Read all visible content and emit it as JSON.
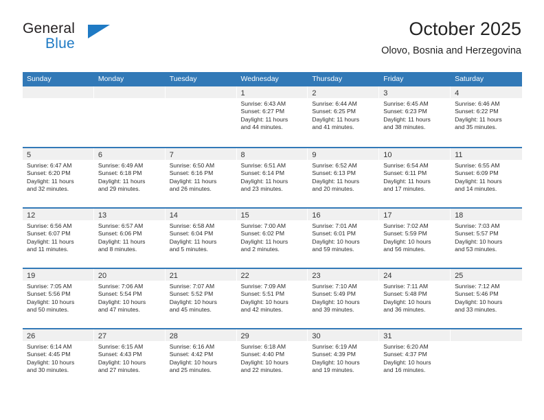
{
  "brand": {
    "name_top": "General",
    "name_bottom": "Blue",
    "accent_color": "#1f7ac4"
  },
  "header": {
    "title": "October 2025",
    "location": "Olovo, Bosnia and Herzegovina"
  },
  "calendar": {
    "header_color": "#3279b7",
    "weekdays": [
      "Sunday",
      "Monday",
      "Tuesday",
      "Wednesday",
      "Thursday",
      "Friday",
      "Saturday"
    ],
    "weeks": [
      [
        {
          "day": ""
        },
        {
          "day": ""
        },
        {
          "day": ""
        },
        {
          "day": "1",
          "sunrise": "Sunrise: 6:43 AM",
          "sunset": "Sunset: 6:27 PM",
          "daylight_1": "Daylight: 11 hours",
          "daylight_2": "and 44 minutes."
        },
        {
          "day": "2",
          "sunrise": "Sunrise: 6:44 AM",
          "sunset": "Sunset: 6:25 PM",
          "daylight_1": "Daylight: 11 hours",
          "daylight_2": "and 41 minutes."
        },
        {
          "day": "3",
          "sunrise": "Sunrise: 6:45 AM",
          "sunset": "Sunset: 6:23 PM",
          "daylight_1": "Daylight: 11 hours",
          "daylight_2": "and 38 minutes."
        },
        {
          "day": "4",
          "sunrise": "Sunrise: 6:46 AM",
          "sunset": "Sunset: 6:22 PM",
          "daylight_1": "Daylight: 11 hours",
          "daylight_2": "and 35 minutes."
        }
      ],
      [
        {
          "day": "5",
          "sunrise": "Sunrise: 6:47 AM",
          "sunset": "Sunset: 6:20 PM",
          "daylight_1": "Daylight: 11 hours",
          "daylight_2": "and 32 minutes."
        },
        {
          "day": "6",
          "sunrise": "Sunrise: 6:49 AM",
          "sunset": "Sunset: 6:18 PM",
          "daylight_1": "Daylight: 11 hours",
          "daylight_2": "and 29 minutes."
        },
        {
          "day": "7",
          "sunrise": "Sunrise: 6:50 AM",
          "sunset": "Sunset: 6:16 PM",
          "daylight_1": "Daylight: 11 hours",
          "daylight_2": "and 26 minutes."
        },
        {
          "day": "8",
          "sunrise": "Sunrise: 6:51 AM",
          "sunset": "Sunset: 6:14 PM",
          "daylight_1": "Daylight: 11 hours",
          "daylight_2": "and 23 minutes."
        },
        {
          "day": "9",
          "sunrise": "Sunrise: 6:52 AM",
          "sunset": "Sunset: 6:13 PM",
          "daylight_1": "Daylight: 11 hours",
          "daylight_2": "and 20 minutes."
        },
        {
          "day": "10",
          "sunrise": "Sunrise: 6:54 AM",
          "sunset": "Sunset: 6:11 PM",
          "daylight_1": "Daylight: 11 hours",
          "daylight_2": "and 17 minutes."
        },
        {
          "day": "11",
          "sunrise": "Sunrise: 6:55 AM",
          "sunset": "Sunset: 6:09 PM",
          "daylight_1": "Daylight: 11 hours",
          "daylight_2": "and 14 minutes."
        }
      ],
      [
        {
          "day": "12",
          "sunrise": "Sunrise: 6:56 AM",
          "sunset": "Sunset: 6:07 PM",
          "daylight_1": "Daylight: 11 hours",
          "daylight_2": "and 11 minutes."
        },
        {
          "day": "13",
          "sunrise": "Sunrise: 6:57 AM",
          "sunset": "Sunset: 6:06 PM",
          "daylight_1": "Daylight: 11 hours",
          "daylight_2": "and 8 minutes."
        },
        {
          "day": "14",
          "sunrise": "Sunrise: 6:58 AM",
          "sunset": "Sunset: 6:04 PM",
          "daylight_1": "Daylight: 11 hours",
          "daylight_2": "and 5 minutes."
        },
        {
          "day": "15",
          "sunrise": "Sunrise: 7:00 AM",
          "sunset": "Sunset: 6:02 PM",
          "daylight_1": "Daylight: 11 hours",
          "daylight_2": "and 2 minutes."
        },
        {
          "day": "16",
          "sunrise": "Sunrise: 7:01 AM",
          "sunset": "Sunset: 6:01 PM",
          "daylight_1": "Daylight: 10 hours",
          "daylight_2": "and 59 minutes."
        },
        {
          "day": "17",
          "sunrise": "Sunrise: 7:02 AM",
          "sunset": "Sunset: 5:59 PM",
          "daylight_1": "Daylight: 10 hours",
          "daylight_2": "and 56 minutes."
        },
        {
          "day": "18",
          "sunrise": "Sunrise: 7:03 AM",
          "sunset": "Sunset: 5:57 PM",
          "daylight_1": "Daylight: 10 hours",
          "daylight_2": "and 53 minutes."
        }
      ],
      [
        {
          "day": "19",
          "sunrise": "Sunrise: 7:05 AM",
          "sunset": "Sunset: 5:56 PM",
          "daylight_1": "Daylight: 10 hours",
          "daylight_2": "and 50 minutes."
        },
        {
          "day": "20",
          "sunrise": "Sunrise: 7:06 AM",
          "sunset": "Sunset: 5:54 PM",
          "daylight_1": "Daylight: 10 hours",
          "daylight_2": "and 47 minutes."
        },
        {
          "day": "21",
          "sunrise": "Sunrise: 7:07 AM",
          "sunset": "Sunset: 5:52 PM",
          "daylight_1": "Daylight: 10 hours",
          "daylight_2": "and 45 minutes."
        },
        {
          "day": "22",
          "sunrise": "Sunrise: 7:09 AM",
          "sunset": "Sunset: 5:51 PM",
          "daylight_1": "Daylight: 10 hours",
          "daylight_2": "and 42 minutes."
        },
        {
          "day": "23",
          "sunrise": "Sunrise: 7:10 AM",
          "sunset": "Sunset: 5:49 PM",
          "daylight_1": "Daylight: 10 hours",
          "daylight_2": "and 39 minutes."
        },
        {
          "day": "24",
          "sunrise": "Sunrise: 7:11 AM",
          "sunset": "Sunset: 5:48 PM",
          "daylight_1": "Daylight: 10 hours",
          "daylight_2": "and 36 minutes."
        },
        {
          "day": "25",
          "sunrise": "Sunrise: 7:12 AM",
          "sunset": "Sunset: 5:46 PM",
          "daylight_1": "Daylight: 10 hours",
          "daylight_2": "and 33 minutes."
        }
      ],
      [
        {
          "day": "26",
          "sunrise": "Sunrise: 6:14 AM",
          "sunset": "Sunset: 4:45 PM",
          "daylight_1": "Daylight: 10 hours",
          "daylight_2": "and 30 minutes."
        },
        {
          "day": "27",
          "sunrise": "Sunrise: 6:15 AM",
          "sunset": "Sunset: 4:43 PM",
          "daylight_1": "Daylight: 10 hours",
          "daylight_2": "and 27 minutes."
        },
        {
          "day": "28",
          "sunrise": "Sunrise: 6:16 AM",
          "sunset": "Sunset: 4:42 PM",
          "daylight_1": "Daylight: 10 hours",
          "daylight_2": "and 25 minutes."
        },
        {
          "day": "29",
          "sunrise": "Sunrise: 6:18 AM",
          "sunset": "Sunset: 4:40 PM",
          "daylight_1": "Daylight: 10 hours",
          "daylight_2": "and 22 minutes."
        },
        {
          "day": "30",
          "sunrise": "Sunrise: 6:19 AM",
          "sunset": "Sunset: 4:39 PM",
          "daylight_1": "Daylight: 10 hours",
          "daylight_2": "and 19 minutes."
        },
        {
          "day": "31",
          "sunrise": "Sunrise: 6:20 AM",
          "sunset": "Sunset: 4:37 PM",
          "daylight_1": "Daylight: 10 hours",
          "daylight_2": "and 16 minutes."
        },
        {
          "day": ""
        }
      ]
    ]
  }
}
